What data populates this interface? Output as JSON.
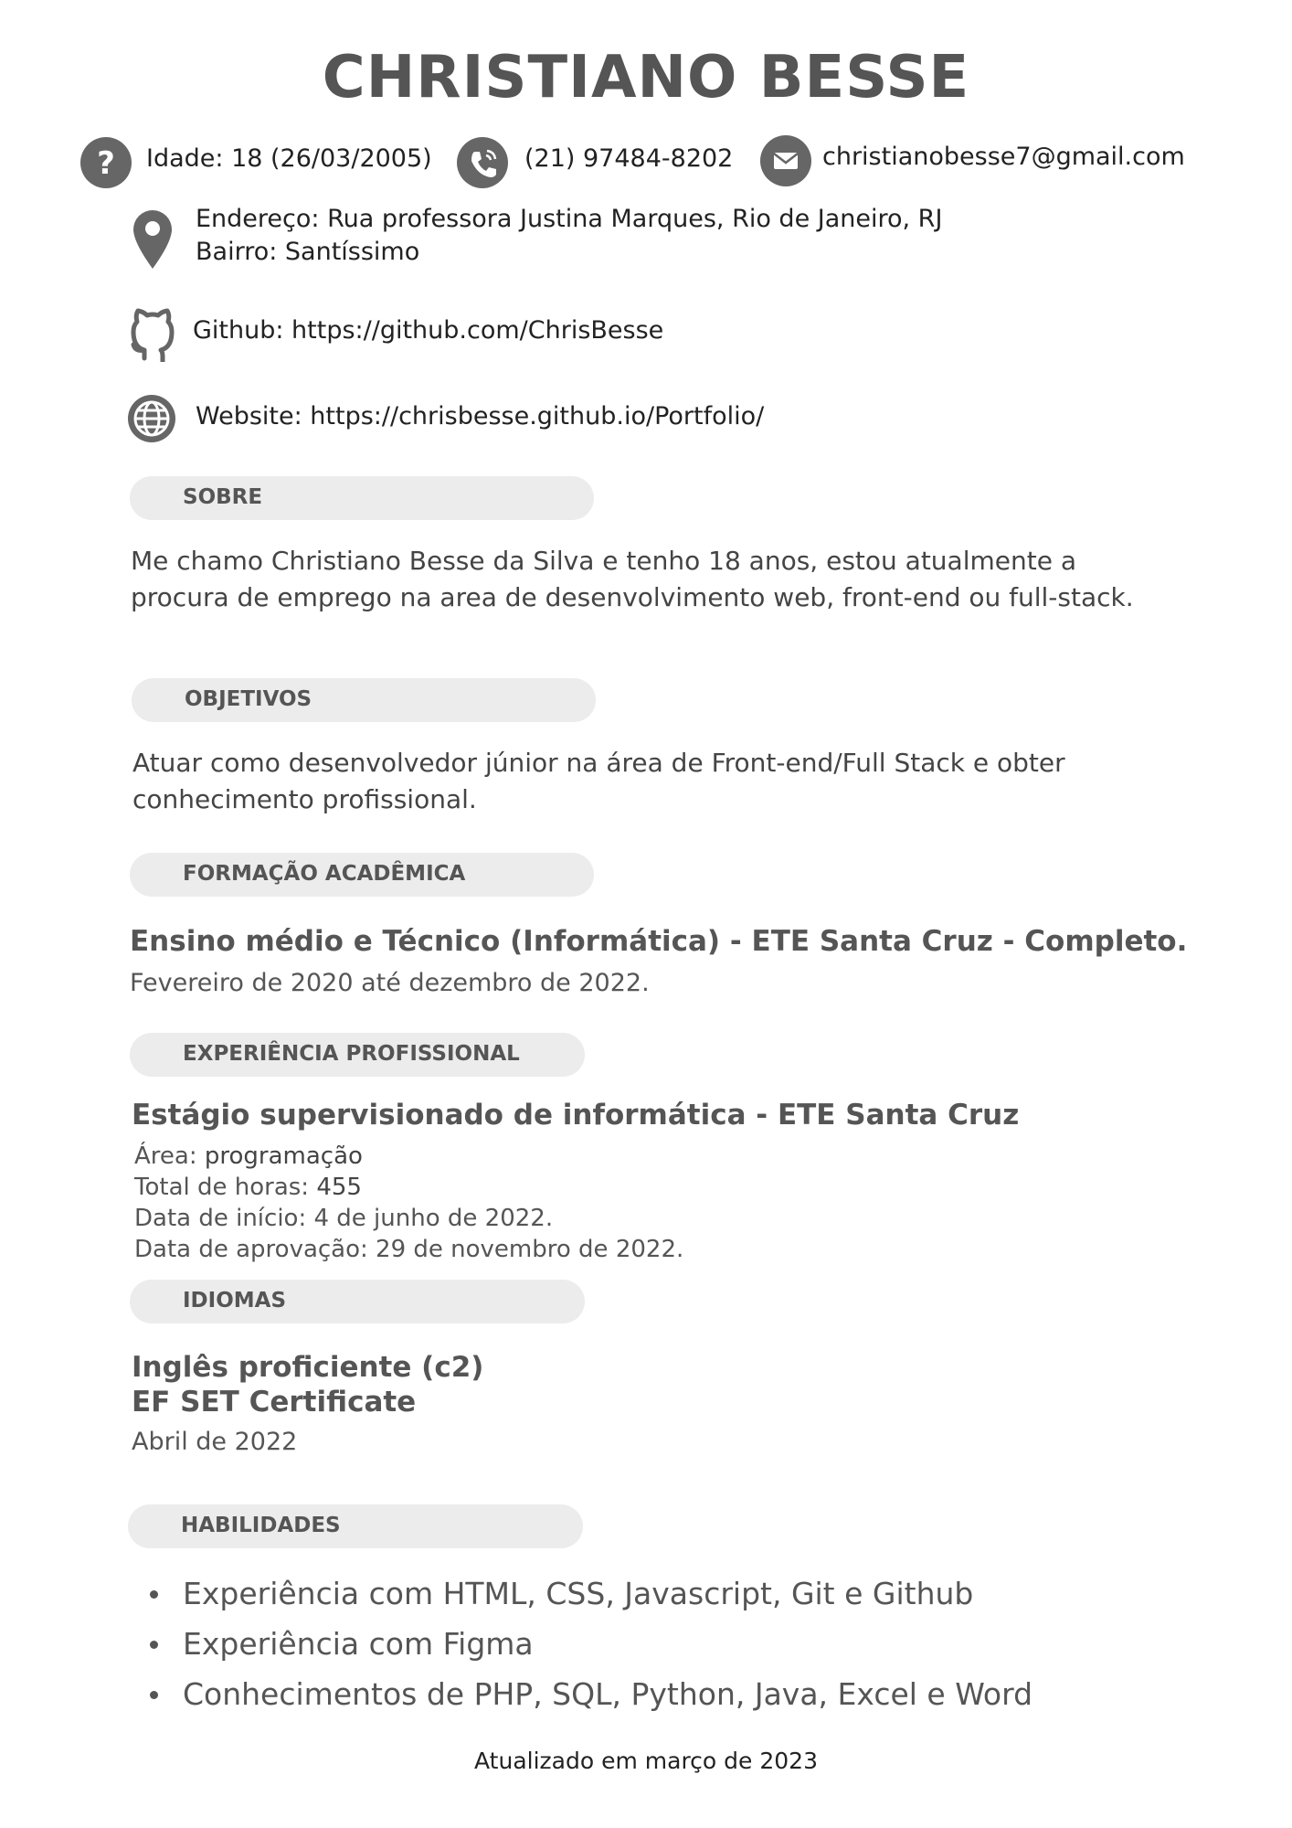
{
  "header": {
    "name": "CHRISTIANO BESSE"
  },
  "contact": {
    "age": "Idade: 18 (26/03/2005)",
    "phone": "(21) 97484-8202",
    "email": "christianobesse7@gmail.com",
    "address_line1": "Endereço: Rua professora Justina Marques, Rio de Janeiro, RJ",
    "address_line2": "Bairro: Santíssimo",
    "github": "Github: https://github.com/ChrisBesse",
    "website": "Website: https://chrisbesse.github.io/Portfolio/",
    "icons": [
      "question-icon",
      "phone-icon",
      "mail-icon",
      "location-pin-icon",
      "github-icon",
      "globe-icon"
    ]
  },
  "sections": {
    "about": {
      "title": "SOBRE",
      "text": "Me chamo Christiano Besse da Silva e tenho 18 anos, estou atualmente a procura de emprego na area de desenvolvimento web, front-end ou full-stack."
    },
    "objectives": {
      "title": "OBJETIVOS",
      "text": "Atuar como desenvolvedor júnior na área de Front-end/Full Stack e obter conhecimento profissional."
    },
    "education": {
      "title": "FORMAÇÃO ACADÊMICA",
      "course": "Ensino médio e Técnico (Informática) - ETE Santa Cruz - Completo.",
      "period": "Fevereiro de 2020 até dezembro de 2022."
    },
    "experience": {
      "title": "EXPERIÊNCIA PROFISSIONAL",
      "role": "Estágio supervisionado de informática - ETE Santa Cruz",
      "area_label": "Área: ",
      "area_value": "programação",
      "hours_label": "Total de horas: ",
      "hours_value": "455",
      "start": "Data de início: 4 de junho de 2022.",
      "approval": "Data de aprovação: 29 de novembro de 2022."
    },
    "languages": {
      "title": "IDIOMAS",
      "line1": "Inglês proficiente (c2)",
      "line2": "EF SET Certificate",
      "date": "Abril de 2022"
    },
    "skills": {
      "title": "HABILIDADES",
      "items": [
        "Experiência com HTML, CSS, Javascript, Git e Github",
        "Experiência com Figma",
        "Conhecimentos de PHP, SQL, Python, Java, Excel e Word"
      ]
    }
  },
  "footer": {
    "text": "Atualizado em março de 2023"
  },
  "colors": {
    "icon": "#666666",
    "pill": "#ececec",
    "heading": "#555555"
  }
}
